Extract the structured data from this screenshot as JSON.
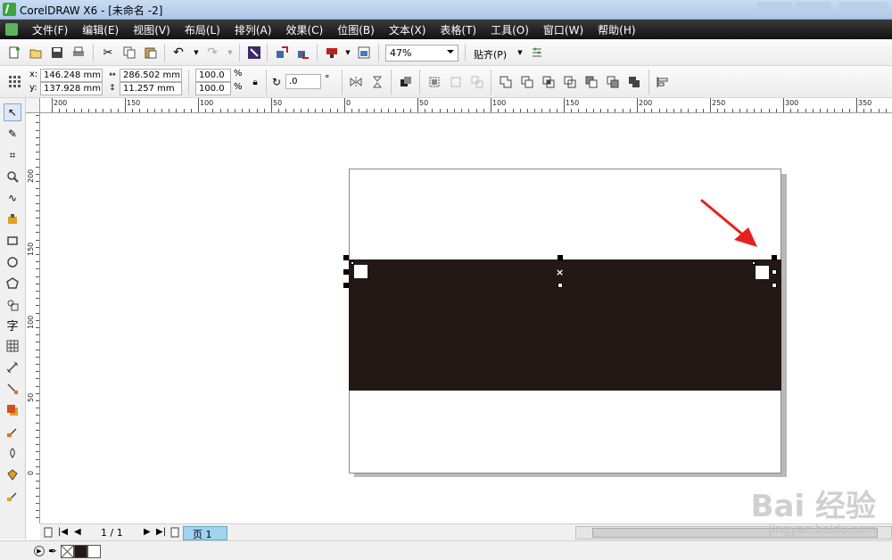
{
  "window": {
    "title": "CorelDRAW X6 - [未命名 -2]"
  },
  "menu": [
    "文件(F)",
    "编辑(E)",
    "视图(V)",
    "布局(L)",
    "排列(A)",
    "效果(C)",
    "位图(B)",
    "文本(X)",
    "表格(T)",
    "工具(O)",
    "窗口(W)",
    "帮助(H)"
  ],
  "toolbar": {
    "zoom": "47%",
    "snap": "贴齐(P)"
  },
  "properties": {
    "x_label": "x:",
    "x": "146.248 mm",
    "y_label": "y:",
    "y": "137.928 mm",
    "width": "286.502 mm",
    "height": "11.257 mm",
    "scale_x": "100.0",
    "scale_y": "100.0",
    "percent": "%",
    "rotation": ".0",
    "degree": "°"
  },
  "ruler_top": [
    "200",
    "150",
    "100",
    "50",
    "0",
    "50",
    "100",
    "150",
    "200",
    "250",
    "300",
    "350"
  ],
  "ruler_left": [
    "200",
    "150",
    "100",
    "50",
    "0"
  ],
  "page_nav": {
    "counter": "1 / 1",
    "tab": "页 1"
  },
  "colors": {
    "rect_fill": "#231815",
    "arrow": "#e8201d",
    "menubar": "#1a1a1a"
  },
  "watermark": {
    "main": "Bai 经验",
    "sub": "jingyan.baidu.com"
  }
}
